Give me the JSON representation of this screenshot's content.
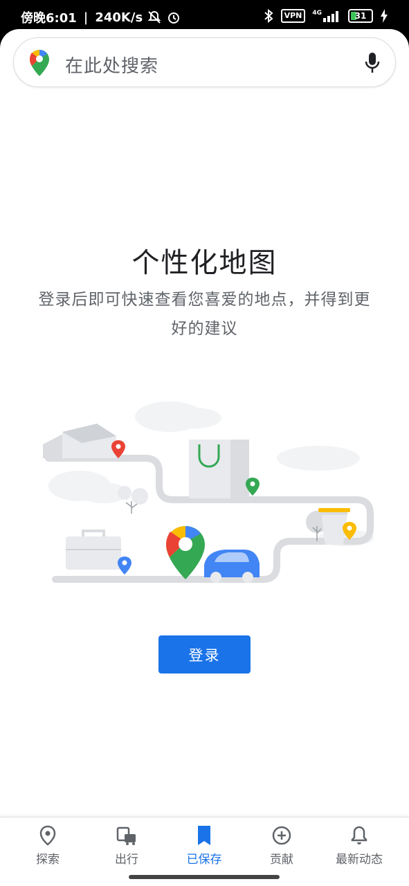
{
  "status_bar": {
    "time": "傍晚6:01",
    "net_speed": "240K/s",
    "vpn": "VPN",
    "signal_label": "4G",
    "battery": "31"
  },
  "search": {
    "placeholder": "在此处搜索"
  },
  "content": {
    "title": "个性化地图",
    "subtitle": "登录后即可快速查看您喜爱的地点，并得到更好的建议"
  },
  "login_button": "登录",
  "bottom_nav": {
    "items": [
      {
        "label": "探索",
        "icon": "location-pin-icon"
      },
      {
        "label": "出行",
        "icon": "commute-icon"
      },
      {
        "label": "已保存",
        "icon": "bookmark-icon",
        "active": true
      },
      {
        "label": "贡献",
        "icon": "add-circle-icon"
      },
      {
        "label": "最新动态",
        "icon": "bell-icon"
      }
    ]
  },
  "colors": {
    "accent": "#1a73e8",
    "text_primary": "#202124",
    "text_secondary": "#5f6368"
  }
}
